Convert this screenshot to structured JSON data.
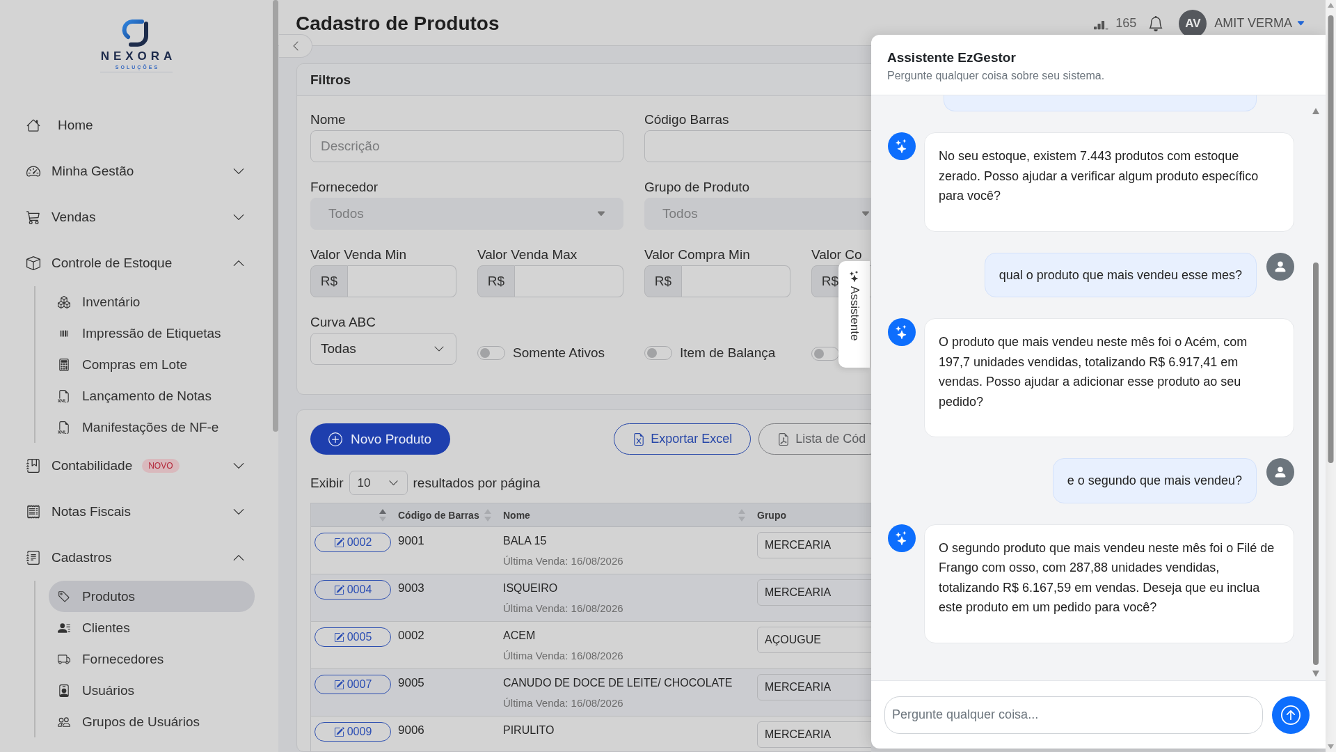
{
  "sidebar": {
    "logo": {
      "wordmark": "NEXORA",
      "subtitle": "SOLUÇÕES"
    },
    "items": [
      {
        "label": "Home",
        "selected": false
      },
      {
        "label": "Minha Gestão",
        "selected": false,
        "expanded": false
      },
      {
        "label": "Vendas",
        "selected": false,
        "expanded": false
      },
      {
        "label": "Controle de Estoque",
        "selected": false,
        "expanded": true,
        "children": [
          {
            "label": "Inventário",
            "selected": false
          },
          {
            "label": "Impressão de Etiquetas",
            "selected": false
          },
          {
            "label": "Compras em Lote",
            "selected": false
          },
          {
            "label": "Lançamento de Notas",
            "selected": false
          },
          {
            "label": "Manifestações de NF-e",
            "selected": false
          }
        ]
      },
      {
        "label": "Contabilidade",
        "selected": false,
        "expanded": false,
        "badge": "NOVO"
      },
      {
        "label": "Notas Fiscais",
        "selected": false,
        "expanded": false
      },
      {
        "label": "Cadastros",
        "selected": false,
        "expanded": true,
        "children": [
          {
            "label": "Produtos",
            "selected": true
          },
          {
            "label": "Clientes",
            "selected": false
          },
          {
            "label": "Fornecedores",
            "selected": false
          },
          {
            "label": "Usuários",
            "selected": false
          },
          {
            "label": "Grupos de Usuários",
            "selected": false
          }
        ]
      }
    ]
  },
  "header": {
    "title": "Cadastro de Produtos",
    "indicator": {
      "count": "165"
    },
    "user": {
      "initials": "AV",
      "name": "AMIT VERMA"
    }
  },
  "filters": {
    "title": "Filtros",
    "fields": [
      {
        "kind": "text",
        "label": "Nome",
        "placeholder": "Descrição"
      },
      {
        "kind": "text",
        "label": "Código Barras"
      },
      {
        "kind": "select",
        "label": "Fornecedor",
        "value": "Todos",
        "disabled": true
      },
      {
        "kind": "select",
        "label": "Grupo de Produto",
        "value": "Todos",
        "disabled": true
      },
      {
        "kind": "money",
        "label": "Valor Venda Min",
        "prefix": "R$"
      },
      {
        "kind": "money",
        "label": "Valor Venda Max",
        "prefix": "R$"
      },
      {
        "kind": "money",
        "label": "Valor Compra Min",
        "prefix": "R$"
      },
      {
        "kind": "money",
        "label": "Valor Co",
        "prefix": "R$"
      },
      {
        "kind": "dropdown",
        "label": "Curva ABC",
        "value": "Todas"
      }
    ],
    "toggles": [
      {
        "label": "Somente Ativos",
        "on": false
      },
      {
        "label": "Item de Balança",
        "on": false
      },
      {
        "on": false
      }
    ]
  },
  "products": {
    "actions": [
      {
        "kind": "primary",
        "label": "Novo Produto"
      },
      {
        "kind": "outline",
        "label": "Exportar Excel"
      },
      {
        "kind": "muted",
        "label": "Lista de Cód"
      }
    ],
    "page_size": {
      "before": "Exibir",
      "value": "10",
      "after": "resultados por página"
    },
    "table": {
      "columns": [
        {
          "sorted": true
        },
        {
          "label": "Código de Barras",
          "sorted": false
        },
        {
          "label": "Nome",
          "sorted": false
        },
        {
          "label": "Grupo"
        }
      ],
      "rows": [
        {
          "code": "0002",
          "barcode": "9001",
          "name": "BALA 15",
          "last_sale": "Última Venda: 16/08/2026",
          "group": "MERCEARIA"
        },
        {
          "code": "0004",
          "barcode": "9003",
          "name": "ISQUEIRO",
          "last_sale": "Última Venda: 16/08/2026",
          "group": "MERCEARIA"
        },
        {
          "code": "0005",
          "barcode": "0002",
          "name": "ACEM",
          "last_sale": "Última Venda: 16/08/2026",
          "group": "AÇOUGUE"
        },
        {
          "code": "0007",
          "barcode": "9005",
          "name": "CANUDO DE DOCE DE LEITE/ CHOCOLATE",
          "last_sale": "Última Venda: 16/08/2026",
          "group": "MERCEARIA"
        },
        {
          "code": "0009",
          "barcode": "9006",
          "name": "PIRULITO",
          "group": "MERCEARIA"
        }
      ]
    }
  },
  "assistant_tab": {
    "label": "Assistente"
  },
  "chat": {
    "title": "Assistente EzGestor",
    "subtitle": "Pergunte qualquer coisa sobre seu sistema.",
    "messages": [
      {
        "kind": "user"
      },
      {
        "kind": "assistant",
        "text": "No seu estoque, existem 7.443 produtos com estoque zerado. Posso ajudar a verificar algum produto específico para você?"
      },
      {
        "kind": "user",
        "text": "qual o produto que mais vendeu esse mes?"
      },
      {
        "kind": "assistant",
        "text": "O produto que mais vendeu neste mês foi o Acém, com 197,7 unidades vendidas, totalizando R$ 6.917,41 em vendas. Posso ajudar a adicionar esse produto ao seu pedido?"
      },
      {
        "kind": "user",
        "text": "e o segundo que mais vendeu?"
      },
      {
        "kind": "assistant",
        "text": "O segundo produto que mais vendeu neste mês foi o Filé de Frango com osso, com 287,88 unidades vendidas, totalizando R$ 6.167,59 em vendas. Deseja que eu inclua este produto em um pedido para você?"
      }
    ],
    "input": {
      "placeholder": "Pergunte qualquer coisa..."
    }
  }
}
